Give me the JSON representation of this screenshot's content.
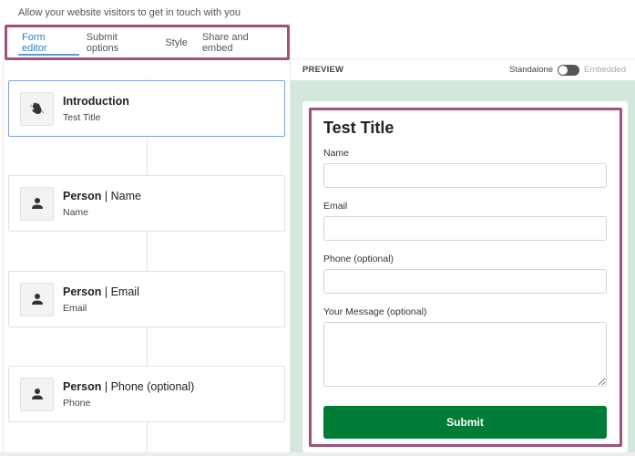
{
  "header": {
    "subtitle": "Allow your website visitors to get in touch with you"
  },
  "tabs": [
    {
      "label": "Form editor",
      "active": true
    },
    {
      "label": "Submit options",
      "active": false
    },
    {
      "label": "Style",
      "active": false
    },
    {
      "label": "Share and embed",
      "active": false
    }
  ],
  "steps": [
    {
      "icon": "waving-hand-icon",
      "title_bold": "Introduction",
      "title_rest": "",
      "subtitle": "Test Title",
      "selected": true
    },
    {
      "icon": "person-icon",
      "title_bold": "Person",
      "title_rest": " | Name",
      "subtitle": "Name",
      "selected": false
    },
    {
      "icon": "person-icon",
      "title_bold": "Person",
      "title_rest": " | Email",
      "subtitle": "Email",
      "selected": false
    },
    {
      "icon": "person-icon",
      "title_bold": "Person",
      "title_rest": " | Phone (optional)",
      "subtitle": "Phone",
      "selected": false
    }
  ],
  "preview": {
    "label": "PREVIEW",
    "mode_left": "Standalone",
    "mode_right": "Embedded",
    "mode_selected": "Standalone",
    "background_color": "#d2e8dc",
    "form": {
      "title": "Test Title",
      "fields": [
        {
          "label": "Name",
          "value": "",
          "type": "input"
        },
        {
          "label": "Email",
          "value": "",
          "type": "input"
        },
        {
          "label": "Phone (optional)",
          "value": "",
          "type": "input"
        },
        {
          "label": "Your Message (optional)",
          "value": "",
          "type": "textarea"
        }
      ],
      "submit_label": "Submit",
      "submit_color": "#007c36"
    }
  },
  "colors": {
    "highlight": "#a0507a",
    "active_tab": "#2f7dc6"
  }
}
